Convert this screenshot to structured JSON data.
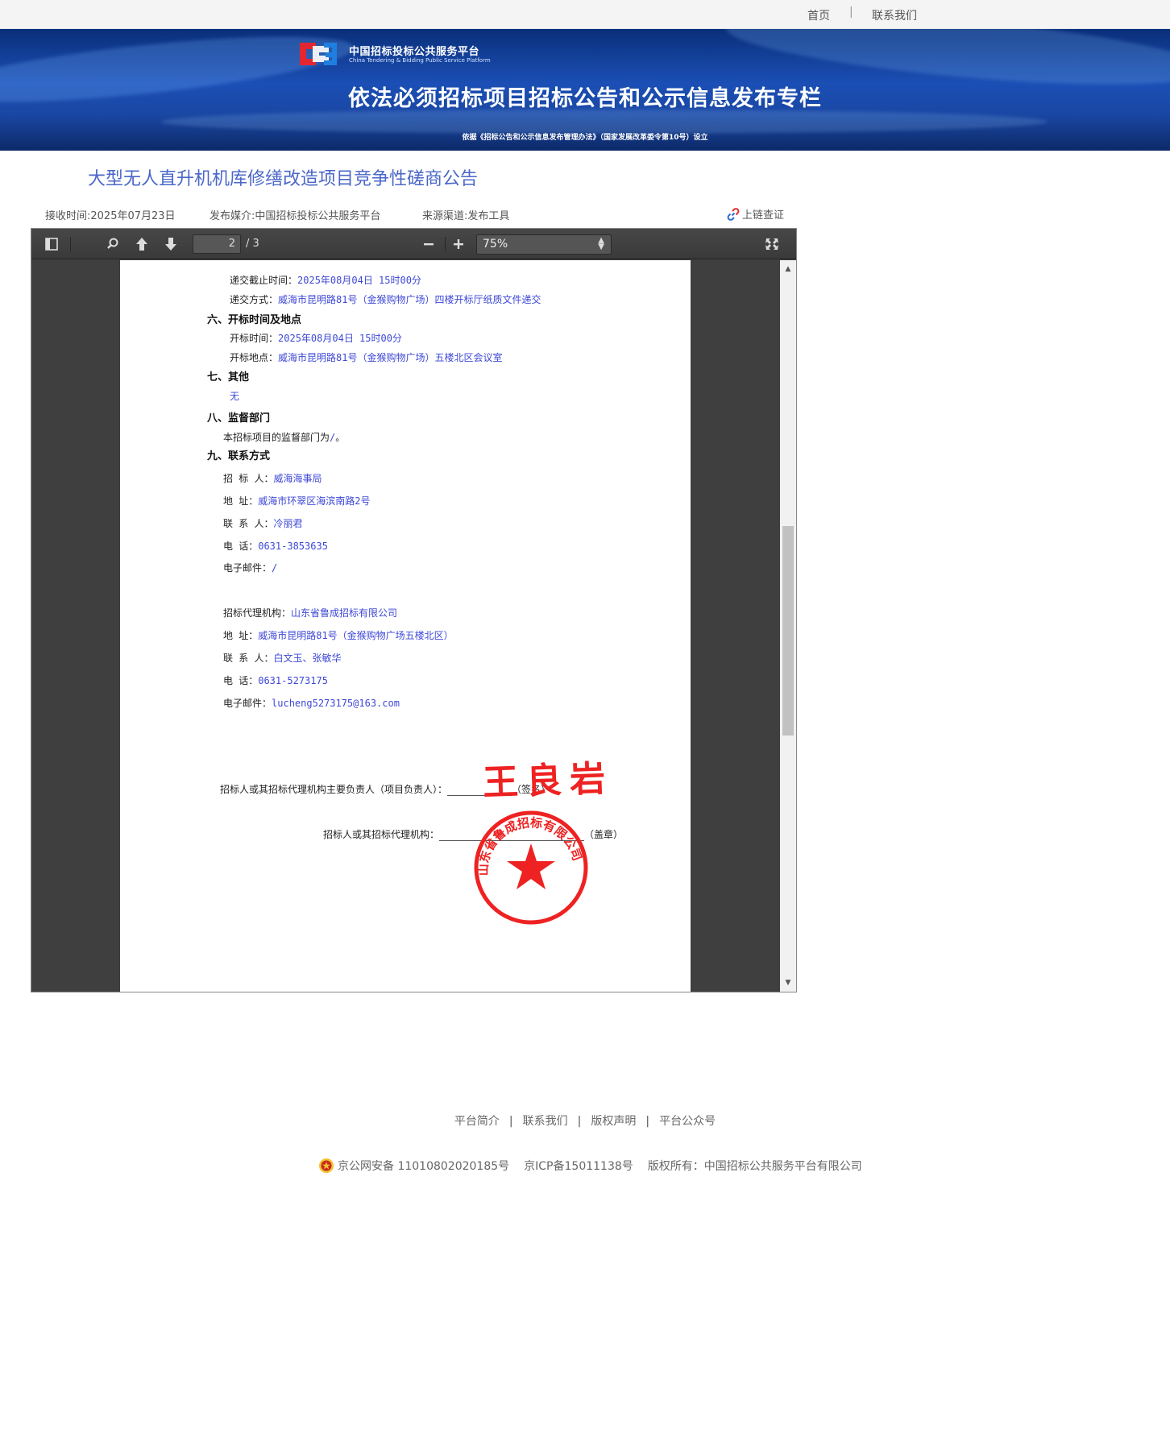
{
  "topnav": {
    "home": "首页",
    "separator": "|",
    "contact": "联系我们"
  },
  "banner": {
    "logo_cn": "中国招标投标公共服务平台",
    "logo_en": "China Tendering & Bidding Public Service Platform",
    "title": "依法必须招标项目招标公告和公示信息发布专栏",
    "subtitle": "依据《招标公告和公示信息发布管理办法》（国家发展改革委令第10号）设立"
  },
  "article": {
    "title": "大型无人直升机机库修缮改造项目竞争性磋商公告",
    "received": "接收时间:2025年07月23日",
    "media": "发布媒介:中国招标投标公共服务平台",
    "source": "来源渠道:发布工具",
    "chain": "上链查证"
  },
  "viewer": {
    "page_current": "2",
    "page_total": "/ 3",
    "zoom": "75%"
  },
  "doc": {
    "deadline_label": "递交截止时间：",
    "deadline_value": "2025年08月04日 15时00分",
    "submit_label": "递交方式：",
    "submit_value": "威海市昆明路81号（金猴购物广场）四楼开标厅纸质文件递交",
    "sec6": "六、开标时间及地点",
    "open_time_label": "开标时间：",
    "open_time_value": "2025年08月04日 15时00分",
    "open_place_label": "开标地点：",
    "open_place_value": "威海市昆明路81号（金猴购物广场）五楼北区会议室",
    "sec7": "七、其他",
    "other_value": "无",
    "sec8": "八、监督部门",
    "supervise_text": "本招标项目的监督部门为",
    "supervise_value": "/",
    "supervise_end": "。",
    "sec9": "九、联系方式",
    "tenderer_label": "招 标 人：",
    "tenderer_value": "威海海事局",
    "addr1_label": "地    址：",
    "addr1_value": "威海市环翠区海滨南路2号",
    "contact1_label": "联 系 人：",
    "contact1_value": "冷丽君",
    "tel1_label": "电    话：",
    "tel1_value": "0631-3853635",
    "email1_label": "电子邮件：",
    "email1_value": "/",
    "agency_label": "招标代理机构：",
    "agency_value": "山东省鲁成招标有限公司",
    "addr2_label": "地    址：",
    "addr2_value": "威海市昆明路81号（金猴购物广场五楼北区）",
    "contact2_label": "联 系 人：",
    "contact2_value": "白文玉、张敏华",
    "tel2_label": "电    话：",
    "tel2_value": "0631-5273175",
    "email2_label": "电子邮件：",
    "email2_value": "lucheng5273175@163.com",
    "sign_line1": "招标人或其招标代理机构主要负责人（项目负责人）：",
    "sign_line1_end": "（签名）",
    "sign_line2": "招标人或其招标代理机构：",
    "sign_line2_end": "（盖章）",
    "signature": "王良岩",
    "seal_text": "山东省鲁成招标有限公司"
  },
  "footer": {
    "links": [
      "平台简介",
      "联系我们",
      "版权声明",
      "平台公众号"
    ],
    "separator": "|",
    "police": "京公网安备 11010802020185号",
    "icp": "京ICP备15011138号",
    "copyright": "版权所有：中国招标公共服务平台有限公司"
  },
  "colors": {
    "title_blue": "#4a67c9",
    "doc_value_blue": "#3d47d6",
    "seal_red": "#ee2222"
  }
}
